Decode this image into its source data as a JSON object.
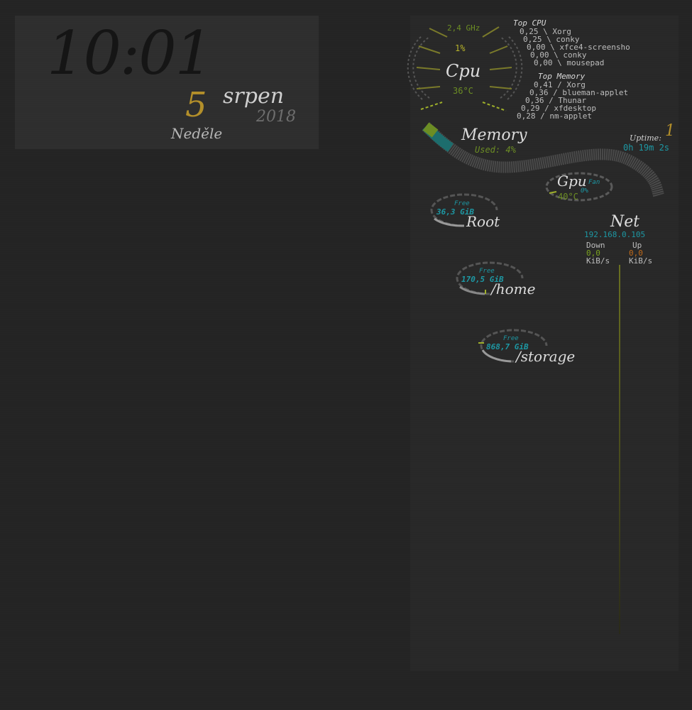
{
  "clock": {
    "time": "10:01",
    "day": "5",
    "month": "srpen",
    "year": "2018",
    "weekday": "Neděle"
  },
  "cpu": {
    "freq": "2,4 GHz",
    "usage": "1%",
    "label": "Cpu",
    "temp": "36°C",
    "top_title": "Top CPU",
    "top": [
      {
        "val": "0,25",
        "name": "Xorg"
      },
      {
        "val": "0,25",
        "name": "conky"
      },
      {
        "val": "0,00",
        "name": "xfce4-screensho"
      },
      {
        "val": "0,00",
        "name": "conky"
      },
      {
        "val": "0,00",
        "name": "mousepad"
      }
    ]
  },
  "memory": {
    "top_title": "Top Memory",
    "top": [
      {
        "val": "0,41",
        "name": "Xorg"
      },
      {
        "val": "0,36",
        "name": "blueman-applet"
      },
      {
        "val": "0,36",
        "name": "Thunar"
      },
      {
        "val": "0,29",
        "name": "xfdesktop"
      },
      {
        "val": "0,28",
        "name": "nm-applet"
      }
    ],
    "label": "Memory",
    "used": "Used: 4%"
  },
  "uptime": {
    "label": "Uptime:",
    "value": "0h 19m 2s",
    "badge": "1"
  },
  "gpu": {
    "label": "Gpu",
    "fan_label": "Fan",
    "fan": "0%",
    "temp": "40°C"
  },
  "disks": [
    {
      "free_label": "Free",
      "free": "36,3 GiB",
      "mount": "Root"
    },
    {
      "free_label": "Free",
      "free": "170,5 GiB",
      "mount": "/home"
    },
    {
      "free_label": "Free",
      "free": "868,7 GiB",
      "mount": "/storage"
    }
  ],
  "net": {
    "label": "Net",
    "ip": "192.168.0.105",
    "down_label": "Down",
    "up_label": "Up",
    "down": "0,0",
    "up": "0,0",
    "down_unit": "KiB/s",
    "up_unit": "KiB/s"
  },
  "colors": {
    "accent_gold": "#b38f2a",
    "accent_cyan": "#1d98a4",
    "accent_green": "#6c8d24",
    "accent_orange": "#c06a1a"
  }
}
